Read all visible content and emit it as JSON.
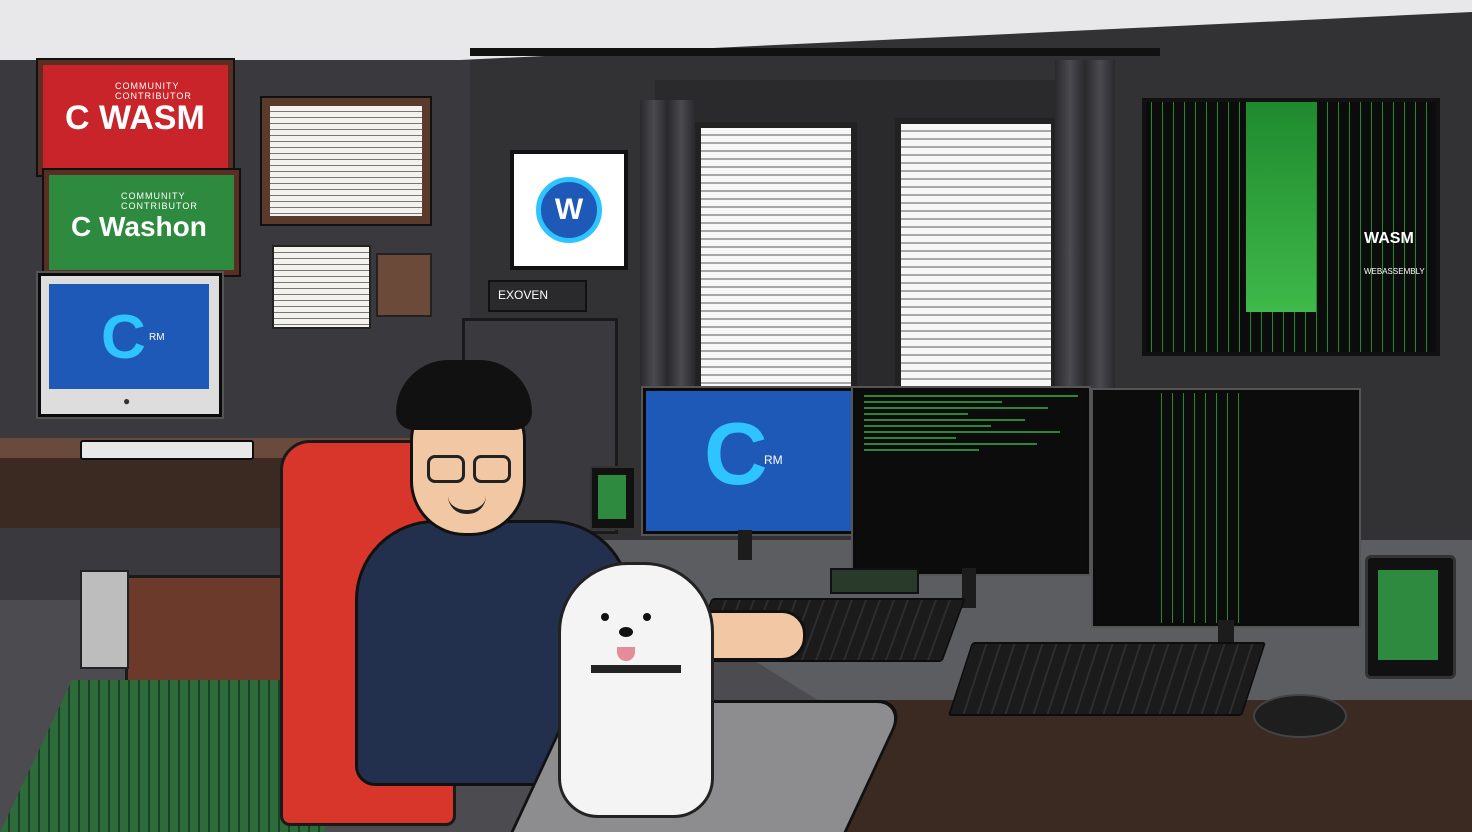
{
  "scene": {
    "colors": {
      "wall": "#323235",
      "sign_red": "#c8242a",
      "sign_green": "#2e8a3e",
      "screen_blue": "#1f59b8",
      "code_green": "#3fb94a",
      "chair_red": "#d9362b",
      "shirt_navy": "#23304d"
    }
  },
  "signs": {
    "red": {
      "small": "COMMUNITY CONTRIBUTOR",
      "big": "C WASM"
    },
    "green": {
      "small": "COMMUNITY CONTRIBUTOR",
      "big": "C Washon"
    }
  },
  "wall_frame": {
    "logo": "W"
  },
  "router": {
    "label": "EXOVEN"
  },
  "poster": {
    "title": "WASM",
    "subtitle": "WEBASSEMBLY"
  },
  "imac": {
    "logo": "C",
    "sub": "RM"
  },
  "monitor_left": {
    "logo": "C",
    "sub": "RM"
  },
  "icons": [
    "apple-logo-icon",
    "mouse-icon"
  ]
}
